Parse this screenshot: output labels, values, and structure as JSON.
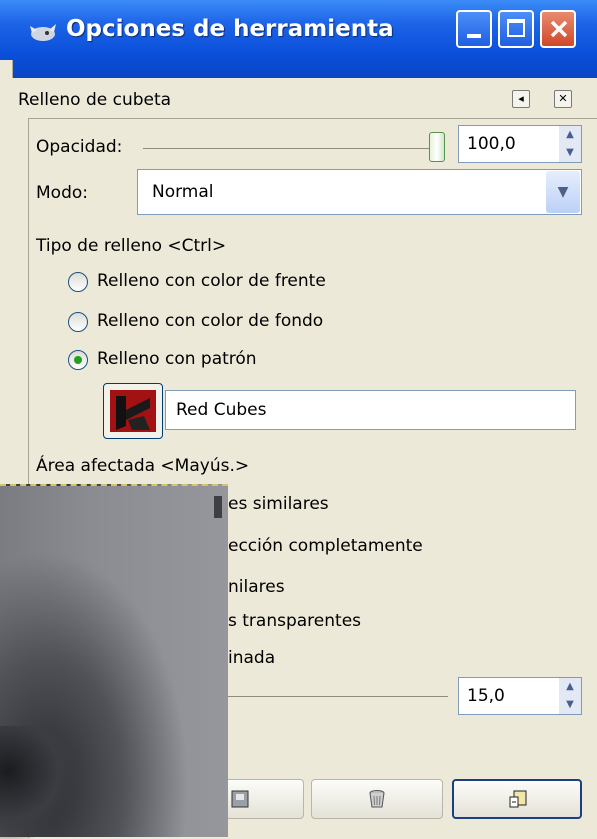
{
  "window": {
    "title": "Opciones de herramienta"
  },
  "dock": {
    "title": "Relleno de cubeta"
  },
  "opacity": {
    "label": "Opacidad:",
    "value": "100,0",
    "level": 1.0
  },
  "mode": {
    "label": "Modo:",
    "value": "Normal"
  },
  "fill_type": {
    "label": "Tipo de relleno  <Ctrl>",
    "options": [
      {
        "label": "Relleno con color de frente",
        "selected": false
      },
      {
        "label": "Relleno con color de fondo",
        "selected": false
      },
      {
        "label": "Relleno con patrón",
        "selected": true
      }
    ],
    "pattern_name": "Red Cubes"
  },
  "affected_area": {
    "label": "Área afectada  <Mayús.>",
    "partial_lines": [
      "es similares",
      "ección completamente",
      "nilares",
      "s transparentes",
      "inada"
    ]
  },
  "threshold": {
    "value": "15,0"
  },
  "colors": {
    "titlebar": "#0a4fd9",
    "panel": "#ece9d8",
    "radio_selected": "#21a121",
    "pattern": "#9e1010"
  }
}
